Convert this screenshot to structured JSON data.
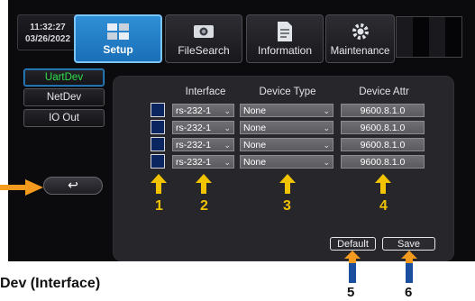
{
  "clock": {
    "time": "11:32:27",
    "date": "03/26/2022"
  },
  "tabs": [
    {
      "label": "Setup",
      "icon": "setup-icon",
      "active": true
    },
    {
      "label": "FileSearch",
      "icon": "camera-icon"
    },
    {
      "label": "Information",
      "icon": "document-icon"
    },
    {
      "label": "Maintenance",
      "icon": "gear-icon"
    }
  ],
  "sidebar": {
    "items": [
      {
        "label": "UartDev",
        "active": true
      },
      {
        "label": "NetDev"
      },
      {
        "label": "IO Out"
      }
    ]
  },
  "back_label": "↩",
  "table": {
    "headers": {
      "interface": "Interface",
      "device_type": "Device Type",
      "device_attr": "Device Attr"
    },
    "rows": [
      {
        "interface": "rs-232-1",
        "device_type": "None",
        "device_attr": "9600.8.1.0"
      },
      {
        "interface": "rs-232-1",
        "device_type": "None",
        "device_attr": "9600.8.1.0"
      },
      {
        "interface": "rs-232-1",
        "device_type": "None",
        "device_attr": "9600.8.1.0"
      },
      {
        "interface": "rs-232-1",
        "device_type": "None",
        "device_attr": "9600.8.1.0"
      }
    ]
  },
  "buttons": {
    "default": "Default",
    "save": "Save"
  },
  "callouts": {
    "n1": "1",
    "n2": "2",
    "n3": "3",
    "n4": "4",
    "n5": "5",
    "n6": "6"
  },
  "caption": "Dev (Interface)",
  "colors": {
    "accent": "#2f8fd6",
    "active_text": "#2ee04a",
    "callout_yellow": "#f2c300",
    "callout_orange": "#f39a1f",
    "callout_blue": "#1a4fa0"
  }
}
